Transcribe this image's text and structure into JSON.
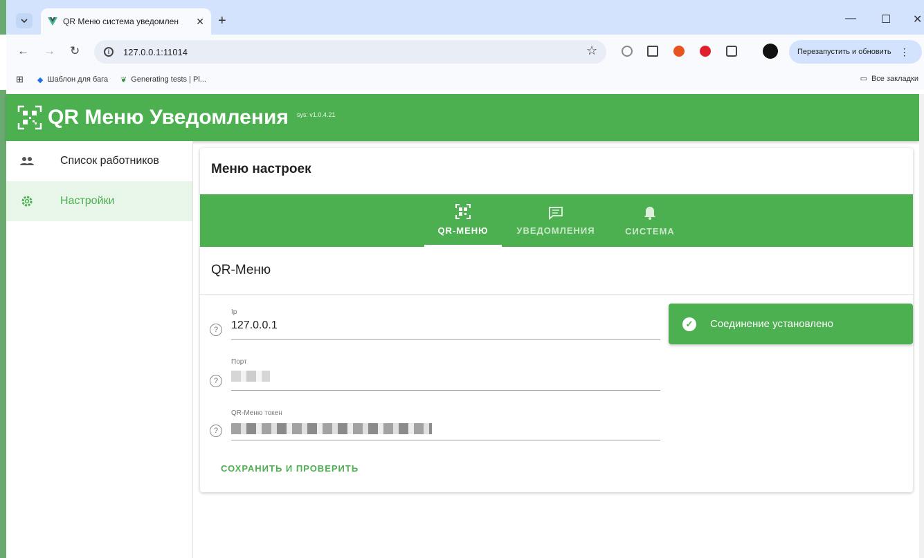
{
  "browser": {
    "tab_title": "QR Меню система уведомлен",
    "url": "127.0.0.1:11014",
    "relaunch_label": "Перезапустить и обновить",
    "bookmarks": [
      "Шаблон для бага",
      "Generating tests | Pl..."
    ],
    "all_bookmarks": "Все закладки"
  },
  "app": {
    "title": "QR Меню Уведомления",
    "version": "sys: v1.0.4.21",
    "accent": "#4caf50"
  },
  "sidebar": {
    "items": [
      {
        "label": "Список работников",
        "icon": "people-icon"
      },
      {
        "label": "Настройки",
        "icon": "gear-icon"
      }
    ]
  },
  "settings": {
    "title": "Меню настроек",
    "tabs": [
      {
        "label": "QR-МЕНЮ",
        "icon": "qr-icon"
      },
      {
        "label": "УВЕДОМЛЕНИЯ",
        "icon": "message-icon"
      },
      {
        "label": "СИСТЕМА",
        "icon": "bell-icon"
      }
    ],
    "section_title": "QR-Меню",
    "fields": {
      "ip": {
        "label": "Ip",
        "value": "127.0.0.1"
      },
      "port": {
        "label": "Порт",
        "value": ""
      },
      "token": {
        "label": "QR-Меню токен",
        "value": ""
      }
    },
    "save_label": "СОХРАНИТЬ И ПРОВЕРИТЬ"
  },
  "toast": {
    "message": "Соединение установлено"
  }
}
